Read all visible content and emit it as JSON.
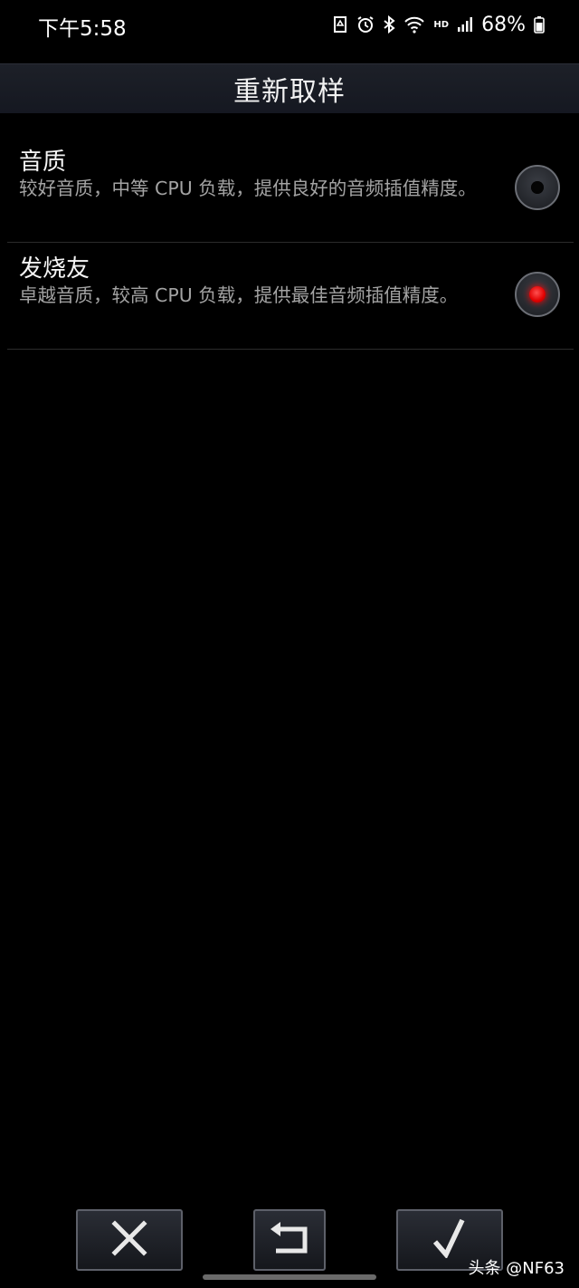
{
  "status_bar": {
    "time": "下午5:58",
    "icons": [
      "recycle-notification-icon",
      "alarm-icon",
      "bluetooth-icon",
      "wifi-icon",
      "hd-voice-icon",
      "signal-icon",
      "battery-icon"
    ],
    "hd_label": "HD",
    "battery": "68%"
  },
  "header": {
    "title": "重新取样"
  },
  "options": [
    {
      "title": "音质",
      "description": "较好音质，中等 CPU 负载，提供良好的音频插值精度。",
      "selected": false
    },
    {
      "title": "发烧友",
      "description": "卓越音质，较高 CPU 负载，提供最佳音频插值精度。",
      "selected": true
    }
  ],
  "colors": {
    "background": "#000000",
    "selected_indicator": "#ff0000",
    "description_text": "#a3a3a3"
  },
  "footer": {
    "buttons": [
      "close-icon",
      "undo-icon",
      "check-icon"
    ]
  },
  "watermark": "头条 @NF63"
}
